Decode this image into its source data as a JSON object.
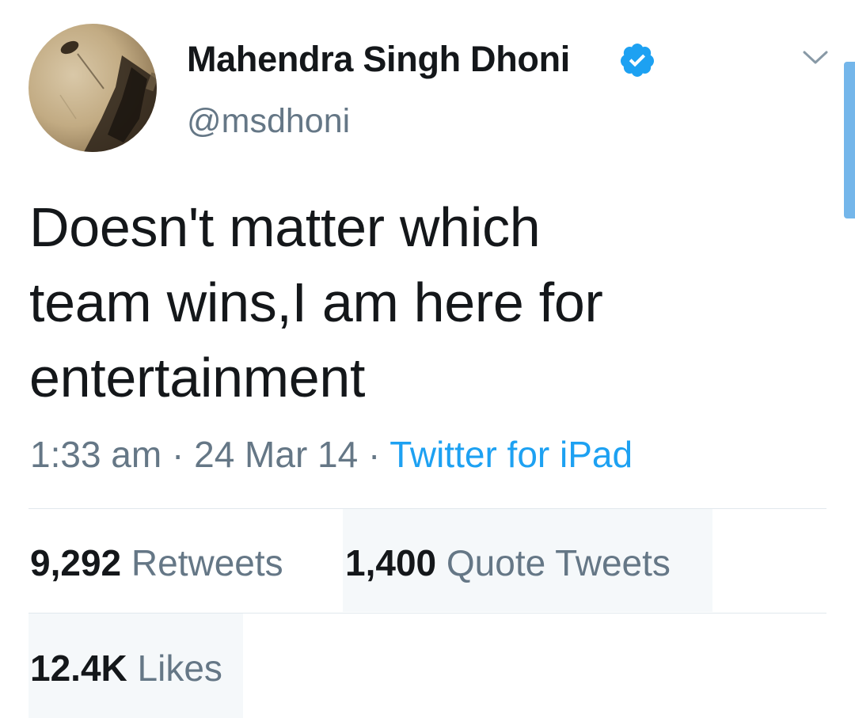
{
  "user": {
    "display_name": "Mahendra Singh Dhoni",
    "handle": "@msdhoni",
    "verified": true,
    "avatar_icon": "profile-photo"
  },
  "tweet": {
    "text": "Doesn't matter which\nteam wins,I am here for\nentertainment",
    "time": "1:33 am",
    "separator": "·",
    "date": "24 Mar 14",
    "source": "Twitter for iPad"
  },
  "stats": {
    "retweets": {
      "count": "9,292",
      "label": "Retweets"
    },
    "quote_tweets": {
      "count": "1,400",
      "label": "Quote Tweets"
    },
    "likes": {
      "count": "12.4K",
      "label": "Likes"
    }
  },
  "colors": {
    "text_primary": "#14171a",
    "text_secondary": "#657786",
    "link": "#1da1f2",
    "verified_badge": "#1da1f2",
    "divider": "#e1e8ed"
  },
  "icons": {
    "verified": "verified-badge-icon",
    "menu": "chevron-down-icon"
  }
}
